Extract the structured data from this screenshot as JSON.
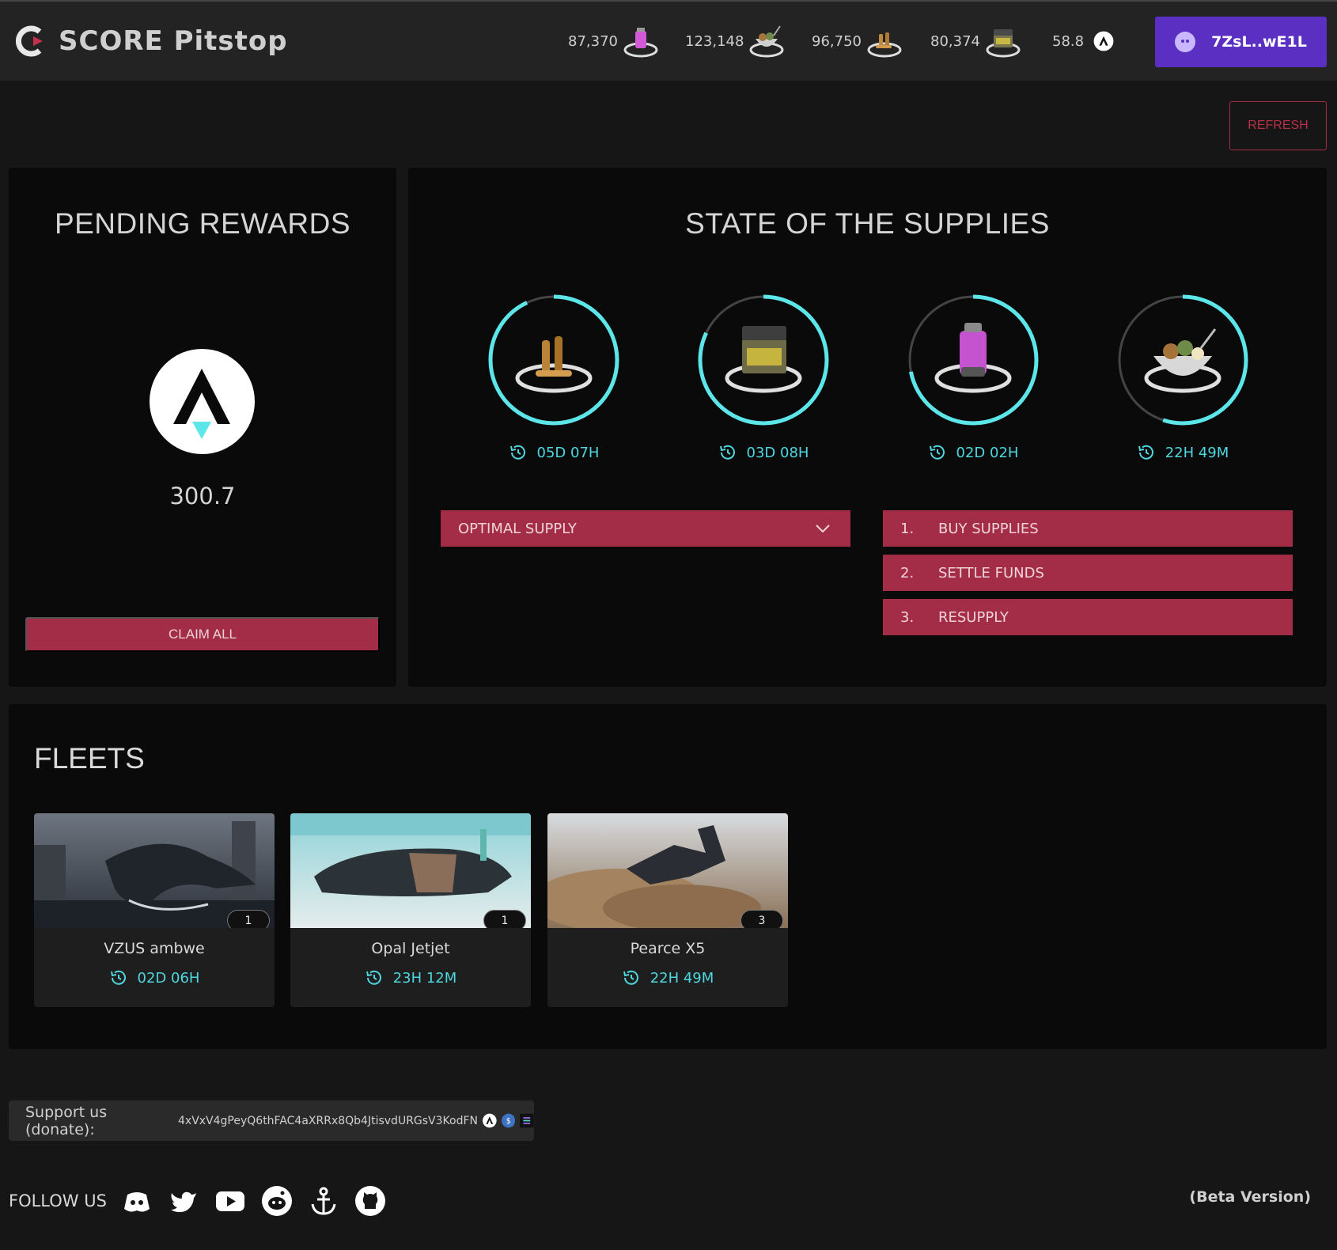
{
  "app": {
    "title": "SCORE Pitstop"
  },
  "header": {
    "stats": [
      {
        "value": "87,370",
        "icon": "fuel-icon"
      },
      {
        "value": "123,148",
        "icon": "food-icon"
      },
      {
        "value": "96,750",
        "icon": "ammo-icon"
      },
      {
        "value": "80,374",
        "icon": "toolkit-icon"
      },
      {
        "value": "58.8",
        "icon": "atlas-icon"
      }
    ],
    "wallet": "7ZsL..wE1L"
  },
  "refresh_label": "REFRESH",
  "pending": {
    "title": "PENDING REWARDS",
    "value": "300.7",
    "claim_label": "CLAIM ALL"
  },
  "supplies": {
    "title": "STATE OF THE SUPPLIES",
    "items": [
      {
        "name": "ammo",
        "icon": "ammo-icon",
        "timer": "05D 07H",
        "level": 0.93
      },
      {
        "name": "toolkit",
        "icon": "toolkit-icon",
        "timer": "03D 08H",
        "level": 0.82
      },
      {
        "name": "fuel",
        "icon": "fuel-icon",
        "timer": "02D 02H",
        "level": 0.72
      },
      {
        "name": "food",
        "icon": "food-icon",
        "timer": "22H 49M",
        "level": 0.55
      }
    ],
    "optimal_label": "OPTIMAL SUPPLY",
    "steps": [
      {
        "num": "1.",
        "label": "BUY SUPPLIES"
      },
      {
        "num": "2.",
        "label": "SETTLE FUNDS"
      },
      {
        "num": "3.",
        "label": "RESUPPLY"
      }
    ]
  },
  "fleets": {
    "title": "FLEETS",
    "cards": [
      {
        "name": "VZUS ambwe",
        "count": "1",
        "timer": "02D 06H"
      },
      {
        "name": "Opal Jetjet",
        "count": "1",
        "timer": "23H 12M"
      },
      {
        "name": "Pearce X5",
        "count": "3",
        "timer": "22H 49M"
      }
    ]
  },
  "footer": {
    "donate_label": "Support us (donate):",
    "donate_address": "4xVxV4gPeyQ6thFAC4aXRRx8Qb4JtisvdURGsV3KodFN",
    "follow_label": "FOLLOW US",
    "beta_label": "(Beta Version)"
  },
  "colors": {
    "accent": "#a32d46",
    "timer": "#4ed7df",
    "wallet": "#5a2fc2",
    "ring": "#5de6ea"
  }
}
